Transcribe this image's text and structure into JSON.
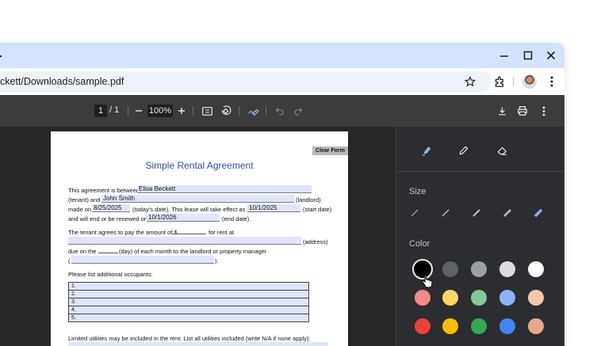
{
  "browser": {
    "url": "ckett/Downloads/sample.pdf",
    "window_controls": [
      "minimize-icon",
      "maximize-icon",
      "close-icon"
    ]
  },
  "pdf_toolbar": {
    "page_current": "1",
    "page_total": "/ 1",
    "zoom": "100%"
  },
  "document": {
    "title": "Simple Rental Agreement",
    "clear_form": "Clear Form",
    "between_text": "This agreement is between",
    "landlord_name": "Elisa Beckett",
    "tenant_and": "(tenant) and",
    "tenant_name": "John Smith",
    "landlord_label": "(landlord)",
    "made_on": "made on",
    "made_date": "8/25/2025",
    "todays_date_text": "(today's date). This lease will take effect as of",
    "start_date": "10/1/2025",
    "start_date_label": "(start date)",
    "will_end": "and will end or be renewed on",
    "end_date": "10/1/2026",
    "end_date_label": "(end date).",
    "pay_text": "The tenant agrees to pay the amount of $",
    "rent_at": "for rent at",
    "address_label": "(address)",
    "due_on": "due on the",
    "day_text": "(day) of each month to the landlord or property manager",
    "paren_open": "(",
    "paren_close": ").",
    "occupants_label": "Please list additional occupants:",
    "occupants": [
      "1.",
      "2.",
      "3.",
      "4.",
      "5."
    ],
    "utilities_text": "Limited utilities may be included in the rent. List all utilities included (write N/A if none apply):"
  },
  "annotation_panel": {
    "tools": [
      "highlighter-icon",
      "pen-icon",
      "eraser-icon"
    ],
    "size_label": "Size",
    "color_label": "Color",
    "colors": [
      [
        "#000000",
        "#5f6368",
        "#9aa0a6",
        "#dadce0",
        "#ffffff"
      ],
      [
        "#f28b82",
        "#fdd663",
        "#81c995",
        "#8ab4f8",
        "#f6c7a8"
      ],
      [
        "#ea4335",
        "#fbbc04",
        "#34a853",
        "#4285f4",
        "#e8a88a"
      ]
    ],
    "selected_color": "#000000"
  }
}
